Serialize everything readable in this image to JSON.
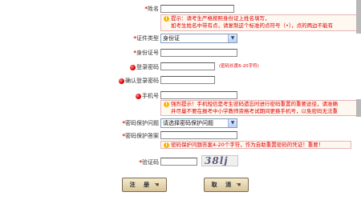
{
  "form": {
    "name": {
      "label": "姓名",
      "hint_line1": "提示：请考生严格按照身份证上姓名填写，",
      "hint_line2": "如考生姓名中带有点，请复制这个标准的点符号（•），点的两边不能有"
    },
    "id_type": {
      "label": "证件类型",
      "selected": "身份证"
    },
    "id_number": {
      "label": "身份证号"
    },
    "password": {
      "label": "登录密码",
      "hint": "(密码长度6-20字符)"
    },
    "confirm_password": {
      "label": "确认登录密码"
    },
    "mobile": {
      "label": "手机号",
      "hint_line1": "强烈提示！手机短信是考生密码遗忘时进行密码重置的重要途径，请准确",
      "hint_line2": "并尽量不要在报考中小学教师资格考试期间更换手机号，以免密码无法重"
    },
    "security_question": {
      "label": "密码保护问题",
      "selected": "请选择密码保护问题"
    },
    "security_answer": {
      "label": "密码保护答案",
      "hint": "密码保护问题答案4-20个字符，作为自助重置密码的凭证！重要！"
    },
    "captcha": {
      "label": "验证码",
      "image_text": "38lj"
    }
  },
  "buttons": {
    "submit": "注 册",
    "cancel": "取 消"
  },
  "colors": {
    "required": "#e00000",
    "hint_bg": "#fff8f0",
    "hint_border": "#e4b4b4",
    "button_top": "#f4ead0",
    "button_bottom": "#d8c59a"
  },
  "icons": {
    "required": "red-dot-icon",
    "warning": "warning-icon",
    "pointer": "hand-pointer-icon"
  }
}
